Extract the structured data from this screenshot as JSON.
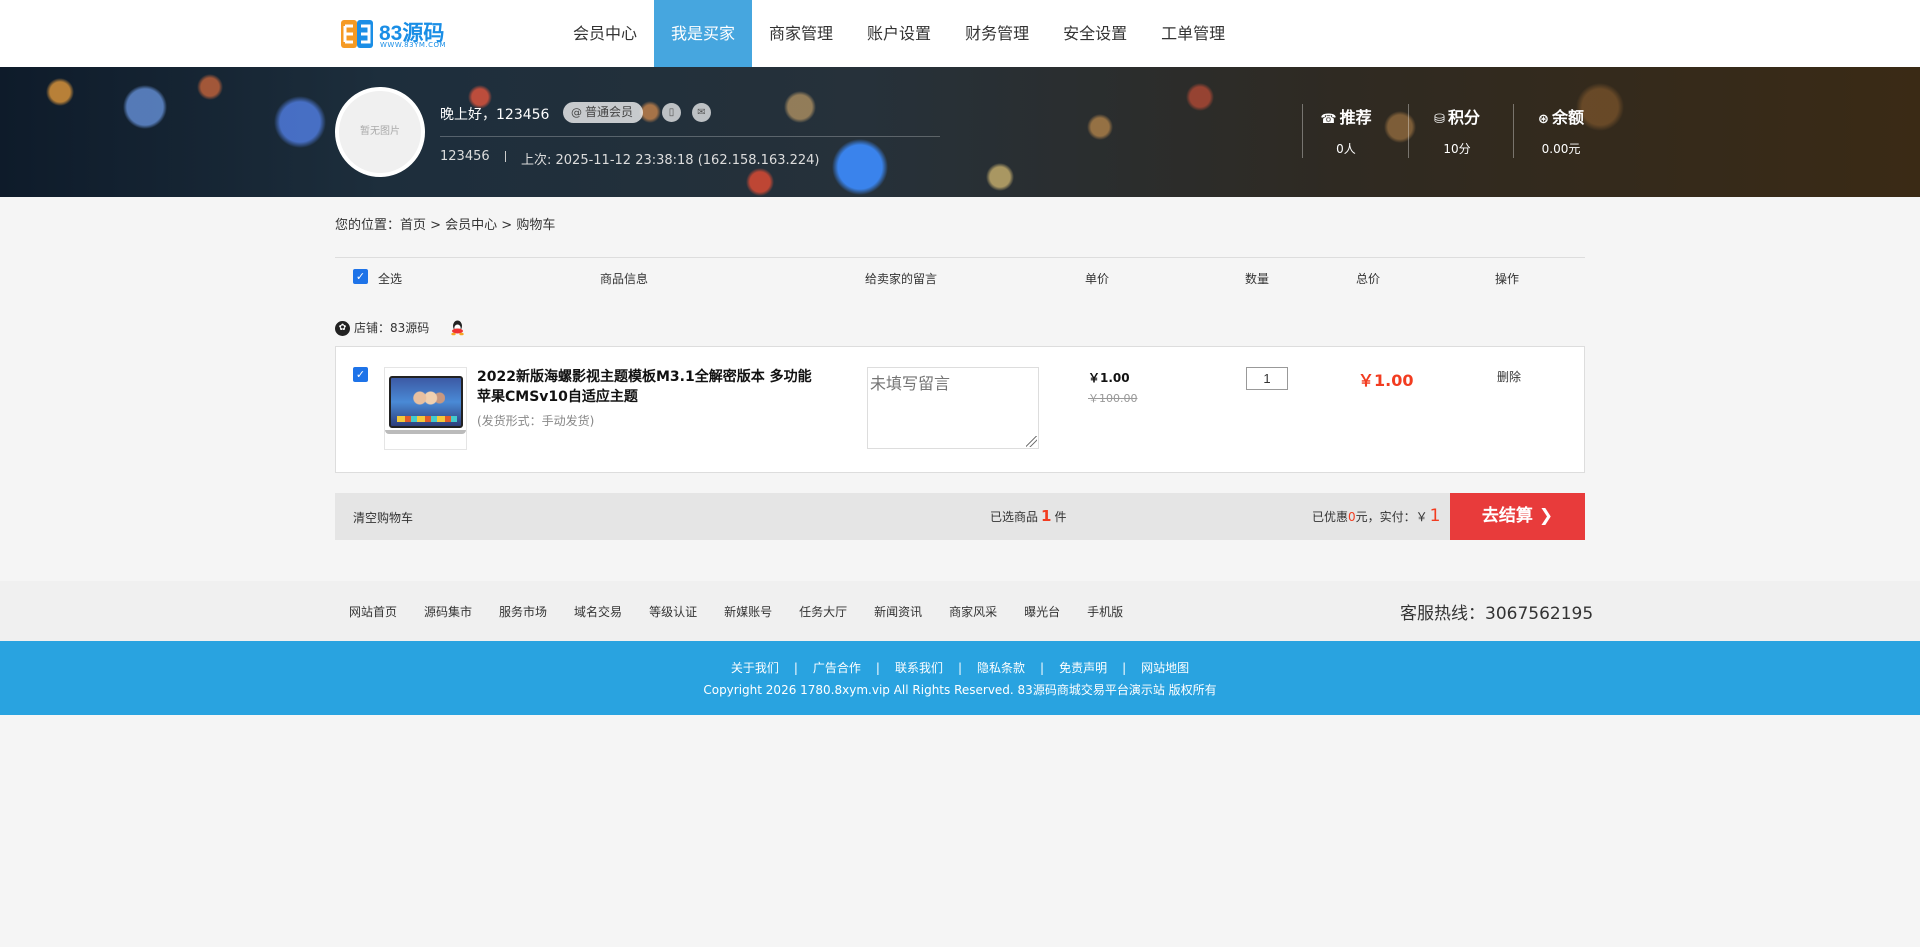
{
  "logo": {
    "name": "83源码",
    "sub": "WWW.83YM.COM"
  },
  "nav": [
    "会员中心",
    "我是买家",
    "商家管理",
    "账户设置",
    "财务管理",
    "安全设置",
    "工单管理"
  ],
  "nav_active": "我是买家",
  "user": {
    "avatar_text": "暂无图片",
    "greeting": "晚上好，123456",
    "level": "普通会员",
    "uid": "123456",
    "last_login": "上次: 2025-11-12 23:38:18 (162.158.163.224)"
  },
  "stats": [
    {
      "label": "推荐",
      "value": "0人",
      "icon": "phone-icon"
    },
    {
      "label": "积分",
      "value": "10分",
      "icon": "coins-icon"
    },
    {
      "label": "余额",
      "value": "0.00元",
      "icon": "yen-icon"
    }
  ],
  "breadcrumb": "您的位置：首页 > 会员中心 > 购物车",
  "cart_header": {
    "select_all": "全选",
    "product": "商品信息",
    "message": "给卖家的留言",
    "unit_price": "单价",
    "quantity": "数量",
    "total": "总价",
    "action": "操作"
  },
  "shop": {
    "label": "店铺：83源码"
  },
  "item": {
    "title": "2022新版海螺影视主题模板M3.1全解密版本 多功能苹果CMSv10自适应主题",
    "delivery": "(发货形式：手动发货)",
    "message_placeholder": "未填写留言",
    "price": "￥1.00",
    "original_price": "￥100.00",
    "quantity": "1",
    "total": "￥1.00",
    "delete": "删除"
  },
  "summary": {
    "clear": "清空购物车",
    "selected_prefix": "已选商品",
    "selected_count": "1",
    "selected_suffix": "件",
    "discount_prefix": "已优惠",
    "discount_value": "0",
    "discount_suffix": "元，实付：￥",
    "pay_amount": "1",
    "checkout": "去结算"
  },
  "footer": {
    "links": [
      "网站首页",
      "源码集市",
      "服务市场",
      "域名交易",
      "等级认证",
      "新媒账号",
      "任务大厅",
      "新闻资讯",
      "商家风采",
      "曝光台",
      "手机版"
    ],
    "hotline": "客服热线：3067562195",
    "bottom_links": [
      "关于我们",
      "广告合作",
      "联系我们",
      "隐私条款",
      "免责声明",
      "网站地图"
    ],
    "copyright": "Copyright 2026 1780.8xym.vip All Rights Reserved. 83源码商城交易平台演示站   版权所有"
  },
  "colors": {
    "accent": "#46a6df",
    "price_red": "#f23c20",
    "checkout": "#e83b3b",
    "footer_blue": "#29a3e0",
    "checkbox": "#1e73e8"
  }
}
